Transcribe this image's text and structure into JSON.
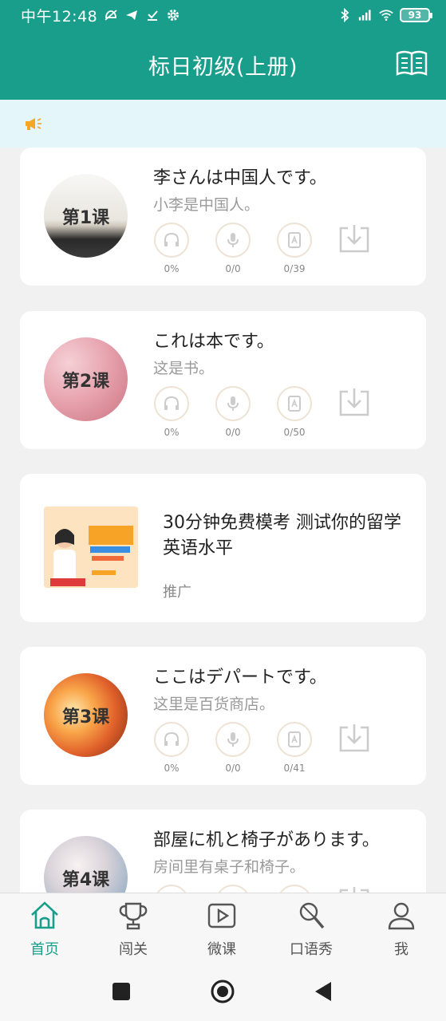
{
  "status_bar": {
    "time": "中午12:48",
    "battery": "93"
  },
  "header": {
    "title": "标日初级(上册)"
  },
  "lessons_top": [
    {
      "label": "第1课",
      "jp": "李さんは中国人です。",
      "cn": "小李是中国人。",
      "listen": "0%",
      "speak": "0/0",
      "vocab": "0/39"
    },
    {
      "label": "第2课",
      "jp": "これは本です。",
      "cn": "这是书。",
      "listen": "0%",
      "speak": "0/0",
      "vocab": "0/50"
    }
  ],
  "ad": {
    "title": "30分钟免费模考 测试你的留学英语水平",
    "tag": "推广"
  },
  "lessons_bottom": [
    {
      "label": "第3课",
      "jp": "ここはデパートです。",
      "cn": "这里是百货商店。",
      "listen": "0%",
      "speak": "0/0",
      "vocab": "0/41"
    },
    {
      "label": "第4课",
      "jp": "部屋に机と椅子があります。",
      "cn": "房间里有桌子和椅子。"
    }
  ],
  "bottom_nav": [
    {
      "label": "首页",
      "icon": "home-icon"
    },
    {
      "label": "闯关",
      "icon": "trophy-icon"
    },
    {
      "label": "微课",
      "icon": "video-play-icon"
    },
    {
      "label": "口语秀",
      "icon": "microphone-icon"
    },
    {
      "label": "我",
      "icon": "profile-icon"
    }
  ],
  "colors": {
    "primary": "#1a9e8c",
    "notice_bg": "#e4f6fa",
    "ring": "#eee2d4"
  }
}
